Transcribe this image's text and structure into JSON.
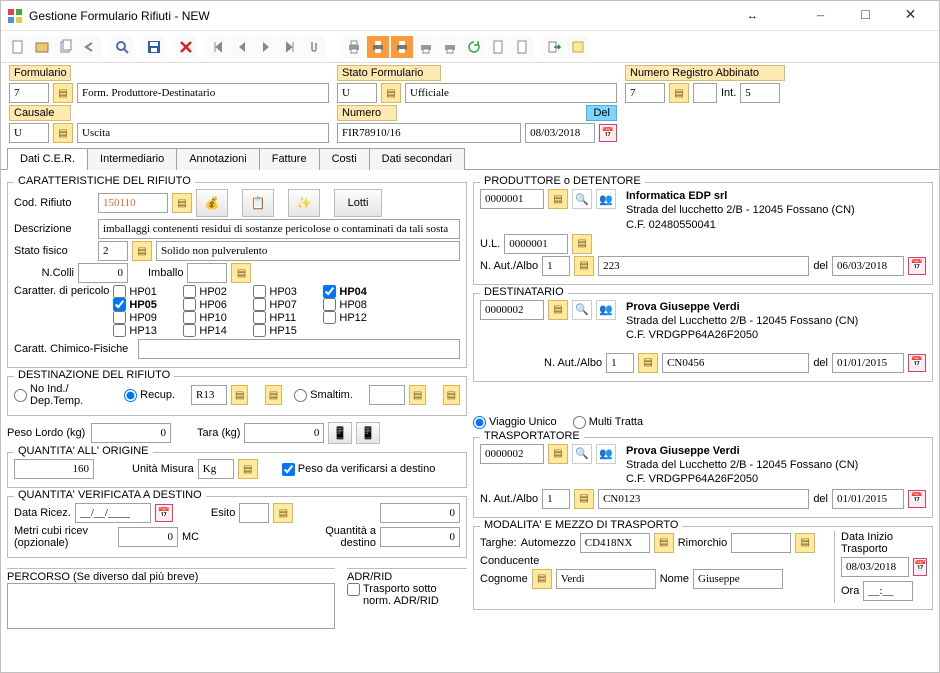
{
  "window": {
    "title": "Gestione Formulario Rifiuti - NEW"
  },
  "header": {
    "formulario_label": "Formulario",
    "formulario_code": "7",
    "formulario_desc": "Form. Produttore-Destinatario",
    "causale_label": "Causale",
    "causale_code": "U",
    "causale_desc": "Uscita",
    "stato_label": "Stato Formulario",
    "stato_code": "U",
    "stato_desc": "Ufficiale",
    "numero_label": "Numero",
    "numero_value": "FIR78910/16",
    "del_label": "Del",
    "del_value": "08/03/2018",
    "numreg_label": "Numero Registro Abbinato",
    "numreg_code": "7",
    "numreg_int_label": "Int.",
    "numreg_int_value": "5"
  },
  "tabs": [
    "Dati C.E.R.",
    "Intermediario",
    "Annotazioni",
    "Fatture",
    "Costi",
    "Dati secondari"
  ],
  "rifiuto": {
    "gb_title": "CARATTERISTICHE DEL RIFIUTO",
    "cod_label": "Cod. Rifiuto",
    "cod_value": "150110",
    "lotti_label": "Lotti",
    "descr_label": "Descrizione",
    "descr_value": "imballaggi contenenti residui di sostanze pericolose o contaminati da tali sosta",
    "stato_fisico_label": "Stato fisico",
    "stato_fisico_code": "2",
    "stato_fisico_desc": "Solido non pulverulento",
    "ncolli_label": "N.Colli",
    "ncolli_value": "0",
    "imballo_label": "Imballo",
    "caratt_label": "Caratter. di pericolo",
    "hp_codes": [
      "HP01",
      "HP02",
      "HP03",
      "HP04",
      "HP05",
      "HP06",
      "HP07",
      "HP08",
      "HP09",
      "HP10",
      "HP11",
      "HP12",
      "HP13",
      "HP14",
      "HP15"
    ],
    "hp_checked": [
      "HP04",
      "HP05"
    ],
    "chimfis_label": "Caratt. Chimico-Fisiche"
  },
  "destinazione": {
    "gb_title": "DESTINAZIONE DEL RIFIUTO",
    "radio_noind": "No Ind./ Dep.Temp.",
    "radio_recup": "Recup.",
    "recup_code": "R13",
    "radio_smaltim": "Smaltim.",
    "peso_lordo_label": "Peso Lordo (kg)",
    "peso_lordo_value": "0",
    "tara_label": "Tara (kg)",
    "tara_value": "0"
  },
  "origine": {
    "gb_title": "QUANTITA'  ALL' ORIGINE",
    "qty_value": "160",
    "um_label": "Unità Misura",
    "um_value": "Kg",
    "verif_label": "Peso da verificarsi a destino"
  },
  "verificata": {
    "gb_title": "QUANTITA' VERIFICATA A DESTINO",
    "data_ricez_label": "Data Ricez.",
    "data_ricez_value": "__/__/____",
    "esito_label": "Esito",
    "qty_value": "0",
    "metri_label": "Metri cubi ricev (opzionale)",
    "metri_value": "0",
    "metri_unit": "MC",
    "qty_destino_label": "Quantità a destino",
    "qty_destino_value": "0"
  },
  "percorso": {
    "label": "PERCORSO (Se diverso dal più breve)",
    "adr_label": "ADR/RID",
    "adr_chk": "Trasporto sotto norm. ADR/RID"
  },
  "produttore": {
    "gb_title": "PRODUTTORE o DETENTORE",
    "code": "0000001",
    "name": "Informatica EDP srl",
    "line1": "Strada del lucchetto 2/B - 12045 Fossano (CN)",
    "line2": "C.F. 02480550041",
    "ul_label": "U.L.",
    "ul_code": "0000001",
    "naut_label": "N. Aut./Albo",
    "naut_seq": "1",
    "naut_value": "223",
    "naut_del_label": "del",
    "naut_del_value": "06/03/2018"
  },
  "destinatario": {
    "gb_title": "DESTINATARIO",
    "code": "0000002",
    "name": "Prova Giuseppe Verdi",
    "line1": "Strada del Lucchetto 2/B - 12045 Fossano (CN)",
    "line2": "C.F. VRDGPP64A26F2050",
    "naut_label": "N. Aut./Albo",
    "naut_seq": "1",
    "naut_value": "CN0456",
    "naut_del_label": "del",
    "naut_del_value": "01/01/2015"
  },
  "tratta": {
    "viaggio_unico": "Viaggio Unico",
    "multi_tratta": "Multi Tratta"
  },
  "trasportatore": {
    "gb_title": "TRASPORTATORE",
    "code": "0000002",
    "name": "Prova Giuseppe Verdi",
    "line1": "Strada del Lucchetto 2/B - 12045 Fossano (CN)",
    "line2": "C.F. VRDGPP64A26F2050",
    "naut_label": "N. Aut./Albo",
    "naut_seq": "1",
    "naut_value": "CN0123",
    "naut_del_label": "del",
    "naut_del_value": "01/01/2015"
  },
  "modalita": {
    "gb_title": "MODALITA' E MEZZO DI TRASPORTO",
    "targhe_label": "Targhe:",
    "automezzo_label": "Automezzo",
    "automezzo_value": "CD418NX",
    "rimorchio_label": "Rimorchio",
    "rimorchio_value": "",
    "conducente_label": "Conducente",
    "cognome_label": "Cognome",
    "cognome_value": "Verdi",
    "nome_label": "Nome",
    "nome_value": "Giuseppe",
    "data_inizio_label": "Data Inizio Trasporto",
    "data_inizio_value": "08/03/2018",
    "ora_label": "Ora",
    "ora_value": "__:__"
  }
}
